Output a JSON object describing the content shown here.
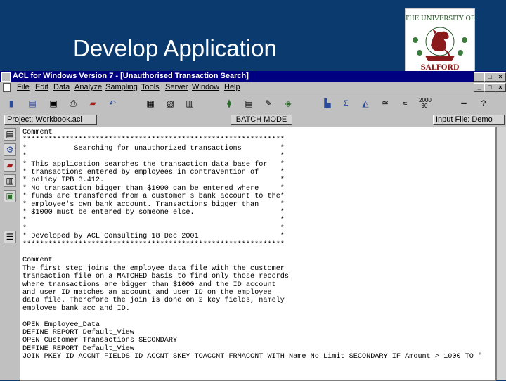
{
  "slide": {
    "title": "Develop Application"
  },
  "logo": {
    "alt": "University of Salford crest",
    "text_top": "THE UNIVERSITY OF",
    "text_bottom": "SALFORD"
  },
  "window": {
    "title": "ACL for Windows Version 7 - [Unauthorised  Transaction  Search]",
    "controls": [
      "_",
      "□",
      "×"
    ],
    "menu": [
      "File",
      "Edit",
      "Data",
      "Analyze",
      "Sampling",
      "Tools",
      "Server",
      "Window",
      "Help"
    ],
    "project_field": "Project: Workbook.acl",
    "batch_mode": "BATCH MODE",
    "input_file": "Input File: Demo"
  },
  "toolbar_icons": [
    "open-icon",
    "save-icon",
    "print-icon",
    "cut-icon",
    "copy-icon",
    "paste-icon",
    "undo-icon",
    "view-icon",
    "report-icon",
    "table-icon",
    "filter-icon",
    "zoom-icon",
    "sum-icon",
    "stratify-icon",
    "sort-icon",
    "graph-icon",
    "year2000-icon",
    "pencil-icon",
    "help-icon"
  ],
  "sidebar_icons": [
    "overview-icon",
    "tools-icon",
    "batch-icon",
    "grid-icon",
    "chart-icon",
    "index-icon"
  ],
  "editor": {
    "lines": [
      "Comment",
      "*************************************************************",
      "*           Searching for unauthorized transactions         *",
      "*                                                           *",
      "* This application searches the transaction data base for   *",
      "* transactions entered by employees in contravention of     *",
      "* policy IPB 3.412.                                         *",
      "* No transaction bigger than $1000 can be entered where     *",
      "* funds are transfered from a customer's bank account to the*",
      "* employee's own bank account. Transactions bigger than     *",
      "* $1000 must be entered by someone else.                    *",
      "*                                                           *",
      "*                                                           *",
      "* Developed by ACL Consulting 18 Dec 2001                   *",
      "*************************************************************",
      "",
      "Comment",
      "The first step joins the employee data file with the customer",
      "transaction file on a MATCHED basis to find only those records",
      "where transactions are bigger than $1000 and the ID account",
      "and user ID matches an account and user ID on the employee",
      "data file. Therefore the join is done on 2 key fields, namely",
      "employee bank acc and ID.",
      "",
      "OPEN Employee_Data",
      "DEFINE REPORT Default_View",
      "OPEN Customer_Transactions SECONDARY",
      "DEFINE REPORT Default_View",
      "JOIN PKEY ID ACCNT FIELDS ID ACCNT SKEY TOACCNT FRMACCNT WITH Name No Limit SECONDARY IF Amount > 1000 TO \""
    ]
  }
}
